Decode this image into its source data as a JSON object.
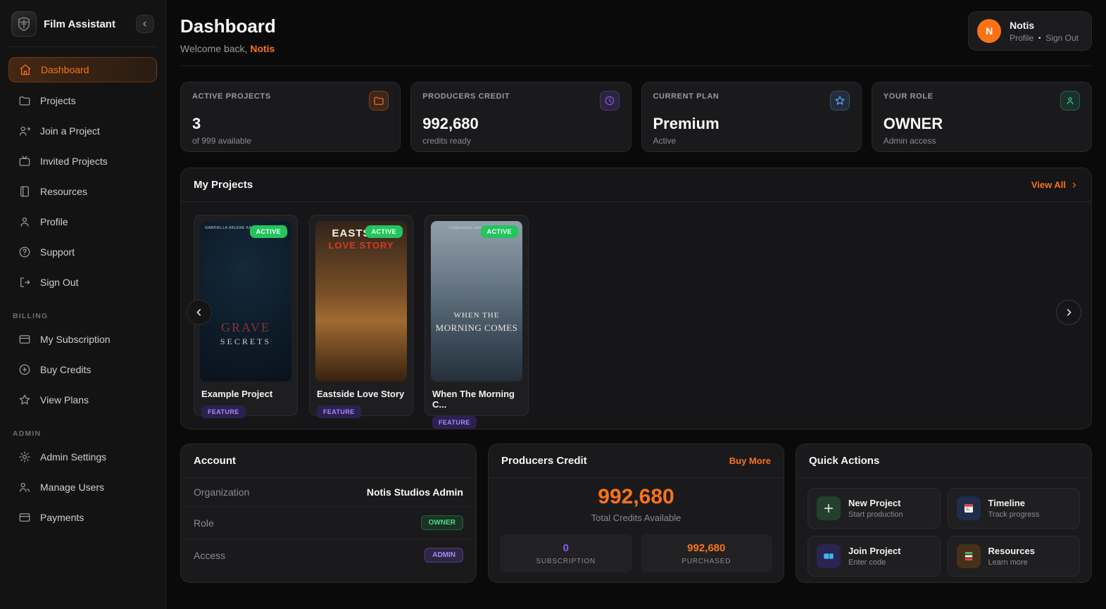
{
  "app": {
    "name": "Film Assistant"
  },
  "sidebar": {
    "nav": [
      {
        "label": "Dashboard",
        "icon": "home-icon",
        "active": true
      },
      {
        "label": "Projects",
        "icon": "folder-icon",
        "active": false
      },
      {
        "label": "Join a Project",
        "icon": "user-plus-icon",
        "active": false
      },
      {
        "label": "Invited Projects",
        "icon": "tv-icon",
        "active": false
      },
      {
        "label": "Resources",
        "icon": "book-icon",
        "active": false
      },
      {
        "label": "Profile",
        "icon": "user-icon",
        "active": false
      },
      {
        "label": "Support",
        "icon": "help-circle-icon",
        "active": false
      },
      {
        "label": "Sign Out",
        "icon": "sign-out-icon",
        "active": false
      }
    ],
    "billing_label": "BILLING",
    "billing": [
      {
        "label": "My Subscription",
        "icon": "credit-card-icon"
      },
      {
        "label": "Buy Credits",
        "icon": "plus-circle-icon"
      },
      {
        "label": "View Plans",
        "icon": "star-icon"
      }
    ],
    "admin_label": "ADMIN",
    "admin": [
      {
        "label": "Admin Settings",
        "icon": "gear-icon"
      },
      {
        "label": "Manage Users",
        "icon": "users-icon"
      },
      {
        "label": "Payments",
        "icon": "credit-card-icon"
      }
    ]
  },
  "header": {
    "title": "Dashboard",
    "welcome_prefix": "Welcome back,",
    "user_name": "Notis"
  },
  "user_widget": {
    "avatar_initial": "N",
    "name": "Notis",
    "profile_label": "Profile",
    "separator": "•",
    "signout_label": "Sign Out"
  },
  "stats": [
    {
      "label": "ACTIVE PROJECTS",
      "value": "3",
      "sub": "of 999 available",
      "icon": "folder-icon",
      "accent": "#f97316"
    },
    {
      "label": "PRODUCERS CREDIT",
      "value": "992,680",
      "sub": "credits ready",
      "icon": "clock-icon",
      "accent": "#8b5cf6"
    },
    {
      "label": "CURRENT PLAN",
      "value": "Premium",
      "sub": "Active",
      "icon": "star-icon",
      "accent": "#60a5fa"
    },
    {
      "label": "YOUR ROLE",
      "value": "OWNER",
      "sub": "Admin access",
      "icon": "person-icon",
      "accent": "#34d399"
    }
  ],
  "my_projects": {
    "title": "My Projects",
    "view_all": "View All",
    "projects": [
      {
        "title": "Example Project",
        "type_badge": "FEATURE",
        "status_badge": "ACTIVE",
        "poster_top": "GABRIELLA ARLENE      KALAYDRIN WILSON",
        "poster_title_1": "GRAVE",
        "poster_title_2": "SECRETS"
      },
      {
        "title": "Eastside Love Story",
        "type_badge": "FEATURE",
        "status_badge": "ACTIVE",
        "poster_top": "",
        "poster_title_1": "EASTSIDE",
        "poster_title_2": "LOVE STORY"
      },
      {
        "title": "When The Morning C...",
        "type_badge": "FEATURE",
        "status_badge": "ACTIVE",
        "poster_top": "Forgiveness comes at a co...",
        "poster_title_1": "WHEN THE",
        "poster_title_2": "MORNING COMES"
      }
    ]
  },
  "account": {
    "title": "Account",
    "rows": [
      {
        "label": "Organization",
        "value": "Notis Studios Admin"
      },
      {
        "label": "Role",
        "value": "OWNER"
      },
      {
        "label": "Access",
        "value": "ADMIN"
      }
    ]
  },
  "credits": {
    "title": "Producers Credit",
    "buy_more": "Buy More",
    "total": "992,680",
    "total_caption": "Total Credits Available",
    "boxes": [
      {
        "value": "0",
        "label": "SUBSCRIPTION"
      },
      {
        "value": "992,680",
        "label": "PURCHASED"
      }
    ]
  },
  "quick_actions": {
    "title": "Quick Actions",
    "actions": [
      {
        "title": "New Project",
        "sub": "Start production",
        "icon": "plus-icon"
      },
      {
        "title": "Timeline",
        "sub": "Track progress",
        "icon": "calendar-icon"
      },
      {
        "title": "Join Project",
        "sub": "Enter code",
        "icon": "ticket-icon"
      },
      {
        "title": "Resources",
        "sub": "Learn more",
        "icon": "book-stack-icon"
      }
    ]
  },
  "colors": {
    "accent_orange": "#f97316",
    "status_green": "#22c55e",
    "purple": "#8b5cf6",
    "blue": "#60a5fa"
  }
}
